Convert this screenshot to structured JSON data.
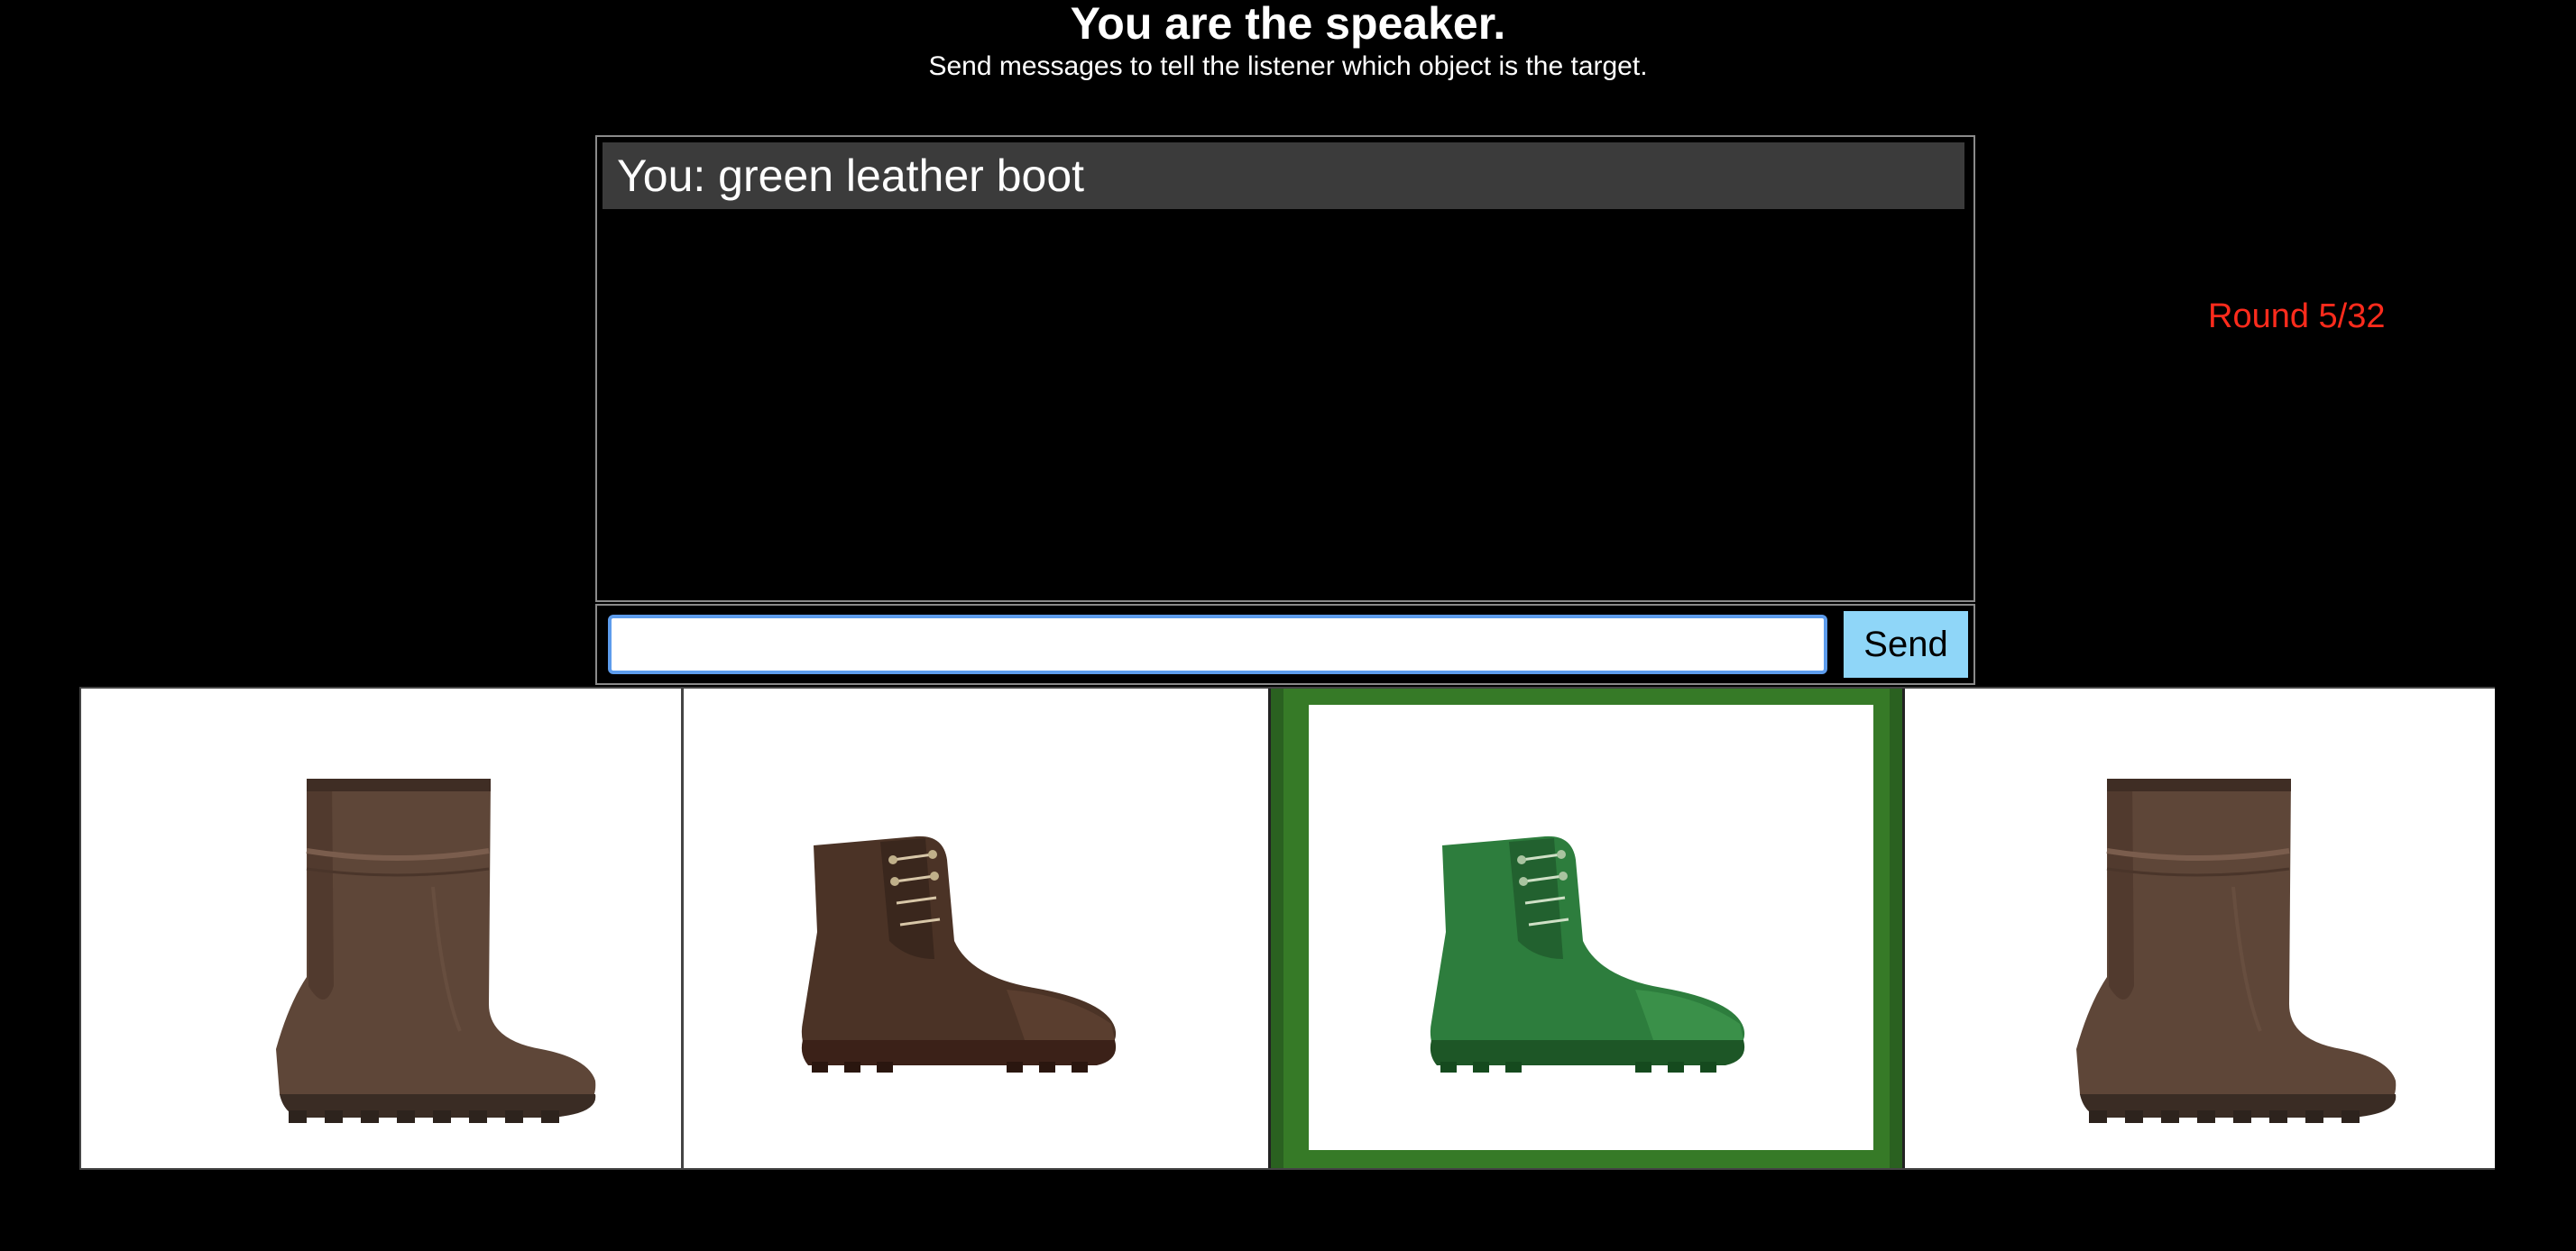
{
  "header": {
    "title": "You are the speaker.",
    "subtitle": "Send messages to tell the listener which object is the target."
  },
  "chat": {
    "messages": [
      {
        "text": "You: green leather boot"
      }
    ]
  },
  "composer": {
    "value": "",
    "placeholder": "",
    "send_label": "Send"
  },
  "status": {
    "round": "Round 5/32",
    "round_color": "#ff2b1c"
  },
  "objects": [
    {
      "kind": "rubber-rain-boot",
      "color": "#5e4638",
      "is_target": false
    },
    {
      "kind": "leather-lace-up-boot",
      "color": "#4b3326",
      "is_target": false
    },
    {
      "kind": "leather-lace-up-boot",
      "color": "#2d7d3d",
      "is_target": true
    },
    {
      "kind": "rubber-rain-boot",
      "color": "#5e4638",
      "is_target": false
    }
  ],
  "colors": {
    "target_highlight": "#367a27",
    "send_button": "#8fd6f8",
    "input_focus": "#5d9cec"
  }
}
